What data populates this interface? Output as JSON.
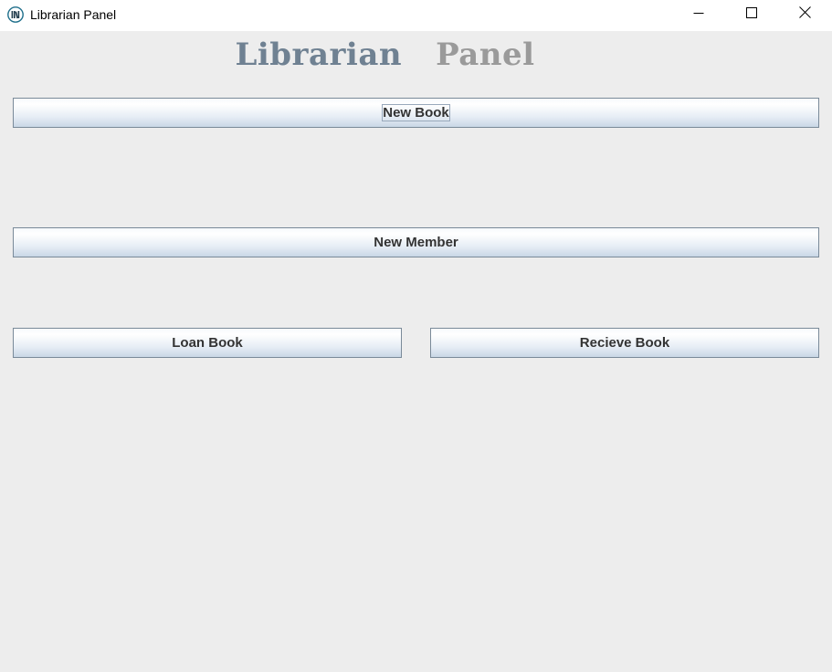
{
  "window": {
    "title": "Librarian Panel",
    "controls": [
      "minimize",
      "maximize",
      "close"
    ]
  },
  "header": {
    "word1": "Librarian",
    "word2": "Panel"
  },
  "buttons": {
    "new_book": "New Book",
    "new_member": "New Member",
    "loan_book": "Loan Book",
    "receive_book": "Recieve Book"
  },
  "colors": {
    "heading_word1": "#6f8192",
    "heading_word2": "#9a9a9a",
    "background": "#ededed",
    "button_border": "#7a8a99"
  },
  "icons": {
    "app": "library-books-icon",
    "minimize": "minimize-icon",
    "maximize": "maximize-icon",
    "close": "close-icon"
  }
}
